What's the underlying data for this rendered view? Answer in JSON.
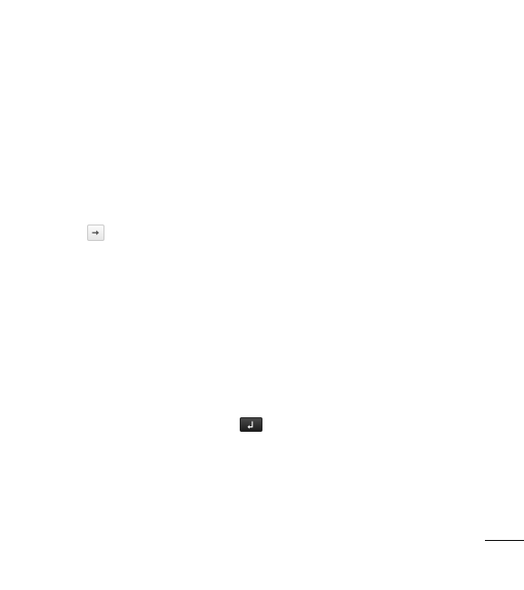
{
  "icons": {
    "arrow_key": "arrow-right-icon",
    "back_key": "back-icon"
  },
  "colors": {
    "background": "#ffffff",
    "arrow_key_fill": "#eeeeee",
    "back_key_fill": "#2a2a2a"
  }
}
